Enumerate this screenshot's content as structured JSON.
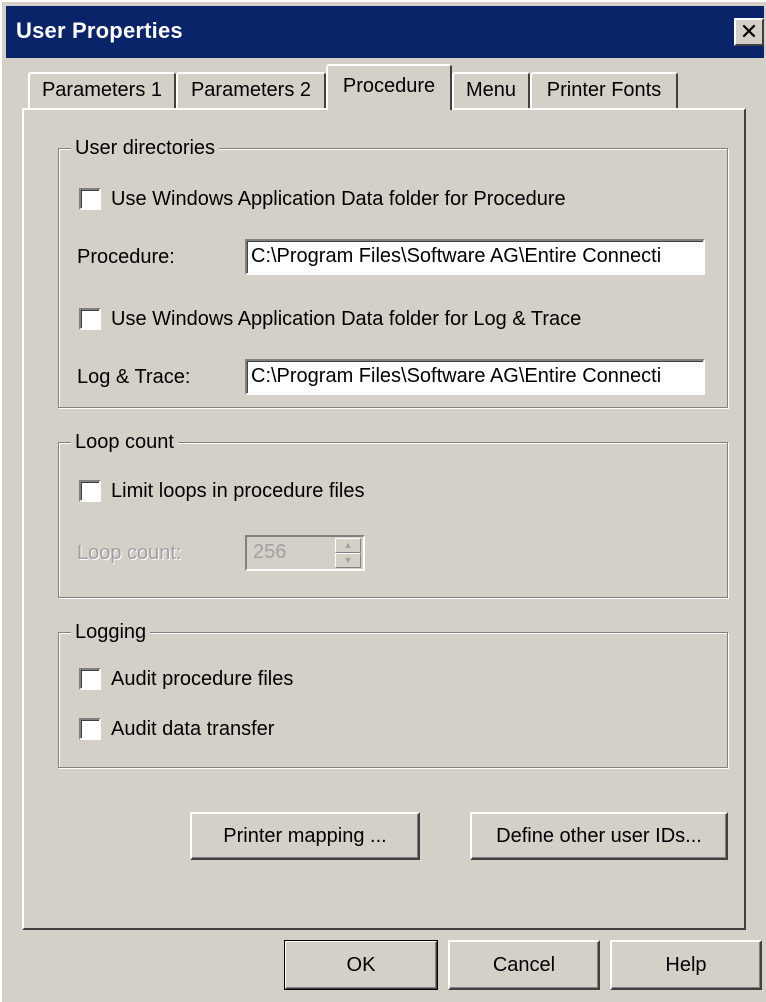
{
  "window": {
    "title": "User Properties",
    "close_glyph": "✕"
  },
  "tabs": [
    {
      "label": "Parameters 1",
      "active": false
    },
    {
      "label": "Parameters 2",
      "active": false
    },
    {
      "label": "Procedure",
      "active": true
    },
    {
      "label": "Menu",
      "active": false
    },
    {
      "label": "Printer Fonts",
      "active": false
    }
  ],
  "user_directories": {
    "group_label": "User directories",
    "use_appdata_procedure": {
      "label": "Use Windows Application Data folder for Procedure",
      "checked": false
    },
    "procedure": {
      "label": "Procedure:",
      "value": "C:\\Program Files\\Software AG\\Entire Connecti"
    },
    "use_appdata_log": {
      "label": "Use Windows Application Data folder for Log & Trace",
      "checked": false
    },
    "log_trace": {
      "label": "Log & Trace:",
      "value": "C:\\Program Files\\Software AG\\Entire Connecti"
    }
  },
  "loop_count": {
    "group_label": "Loop count",
    "limit_loops": {
      "label": "Limit loops in procedure files",
      "checked": false
    },
    "count_label": "Loop count:",
    "count_value": "256",
    "enabled": false
  },
  "logging": {
    "group_label": "Logging",
    "audit_procedure": {
      "label": "Audit procedure files",
      "checked": false
    },
    "audit_transfer": {
      "label": "Audit data transfer",
      "checked": false
    }
  },
  "actions": {
    "printer_mapping": "Printer mapping ...",
    "define_user_ids": "Define other user IDs..."
  },
  "footer": {
    "ok": "OK",
    "cancel": "Cancel",
    "help": "Help"
  }
}
